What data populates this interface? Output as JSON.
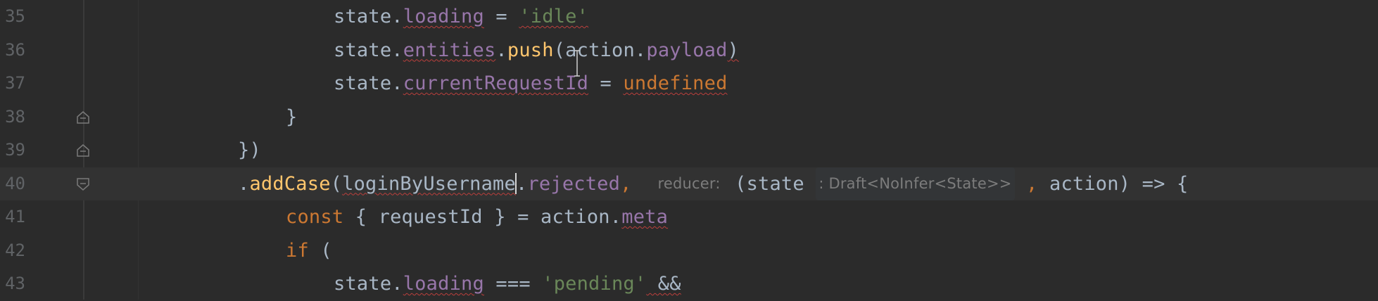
{
  "editor": {
    "lines": [
      {
        "num": "35",
        "parts": [
          "state",
          ".",
          "loading",
          " = ",
          "'idle'"
        ]
      },
      {
        "num": "36",
        "parts": [
          "state",
          ".",
          "entities",
          ".",
          "push",
          "(",
          "action",
          ".",
          "payload",
          ")"
        ]
      },
      {
        "num": "37",
        "parts": [
          "state",
          ".",
          "currentRequestId",
          " = ",
          "undefined"
        ]
      },
      {
        "num": "38",
        "parts": [
          "}"
        ]
      },
      {
        "num": "39",
        "parts": [
          "})"
        ]
      },
      {
        "num": "40",
        "parts": [
          ".",
          "addCase",
          "(",
          "loginByUsername",
          ".",
          "rejected",
          ",",
          "reducer:",
          "(state",
          ": Draft<NoInfer<State>>",
          ",",
          "action",
          ") => {"
        ]
      },
      {
        "num": "41",
        "parts": [
          "const",
          " { requestId } = ",
          "action",
          ".",
          "meta"
        ]
      },
      {
        "num": "42",
        "parts": [
          "if",
          " ("
        ]
      },
      {
        "num": "43",
        "parts": [
          "state",
          ".",
          "loading",
          " === ",
          "'pending'",
          " &&"
        ]
      }
    ]
  },
  "colors": {
    "background": "#2b2b2b",
    "current_line": "#323232",
    "identifier": "#a9b7c6",
    "property": "#9876aa",
    "function": "#ffc66d",
    "keyword": "#cc7832",
    "string": "#6a8759",
    "line_number": "#606366",
    "error_underline": "#bc3f3c"
  },
  "icons": {
    "fold_start": "fold-collapse-icon",
    "fold_end": "fold-end-icon"
  }
}
